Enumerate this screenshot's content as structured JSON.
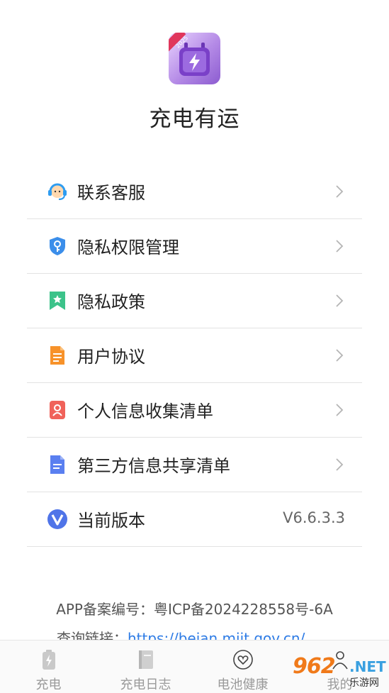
{
  "app": {
    "name": "充电有运",
    "icon_badge": "2025"
  },
  "menu": [
    {
      "label": "联系客服",
      "icon": "customer-service-icon"
    },
    {
      "label": "隐私权限管理",
      "icon": "shield-key-icon"
    },
    {
      "label": "隐私政策",
      "icon": "bookmark-star-icon"
    },
    {
      "label": "用户协议",
      "icon": "document-icon"
    },
    {
      "label": "个人信息收集清单",
      "icon": "person-card-icon"
    },
    {
      "label": "第三方信息共享清单",
      "icon": "file-list-icon"
    },
    {
      "label": "当前版本",
      "icon": "v-logo-icon",
      "value": "V6.6.3.3"
    }
  ],
  "footer": {
    "icp": "APP备案编号：粤ICP备2024228558号-6A",
    "query_label": "查询链接：",
    "query_link": "https://beian.miit.gov.cn/"
  },
  "tabs": [
    {
      "label": "充电",
      "icon": "battery-icon"
    },
    {
      "label": "充电日志",
      "icon": "book-icon"
    },
    {
      "label": "电池健康",
      "icon": "heart-icon"
    },
    {
      "label": "我的",
      "icon": "person-icon"
    }
  ],
  "watermark": {
    "big": "962",
    "net": ".NET",
    "sub": "乐游网"
  },
  "colors": {
    "accent_purple": "#8c5cd0",
    "link_blue": "#2d7be5",
    "divider": "#e3e3e3"
  }
}
